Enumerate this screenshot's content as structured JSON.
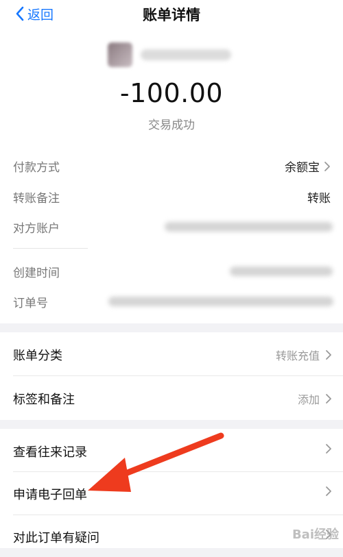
{
  "header": {
    "back_label": "返回",
    "title": "账单详情"
  },
  "transaction": {
    "amount": "-100.00",
    "status": "交易成功"
  },
  "details": {
    "payment_method": {
      "label": "付款方式",
      "value": "余额宝"
    },
    "transfer_note": {
      "label": "转账备注",
      "value": "转账"
    },
    "counterparty": {
      "label": "对方账户"
    },
    "created_time": {
      "label": "创建时间"
    },
    "order_no": {
      "label": "订单号"
    }
  },
  "category": {
    "bill_category": {
      "label": "账单分类",
      "value": "转账充值"
    },
    "tags": {
      "label": "标签和备注",
      "value": "添加"
    }
  },
  "actions": [
    {
      "label": "查看往来记录"
    },
    {
      "label": "申请电子回单"
    },
    {
      "label": "对此订单有疑问"
    }
  ],
  "watermark": "Bai经验",
  "colors": {
    "accent": "#1677ff",
    "arrow": "#ee3b1e"
  }
}
